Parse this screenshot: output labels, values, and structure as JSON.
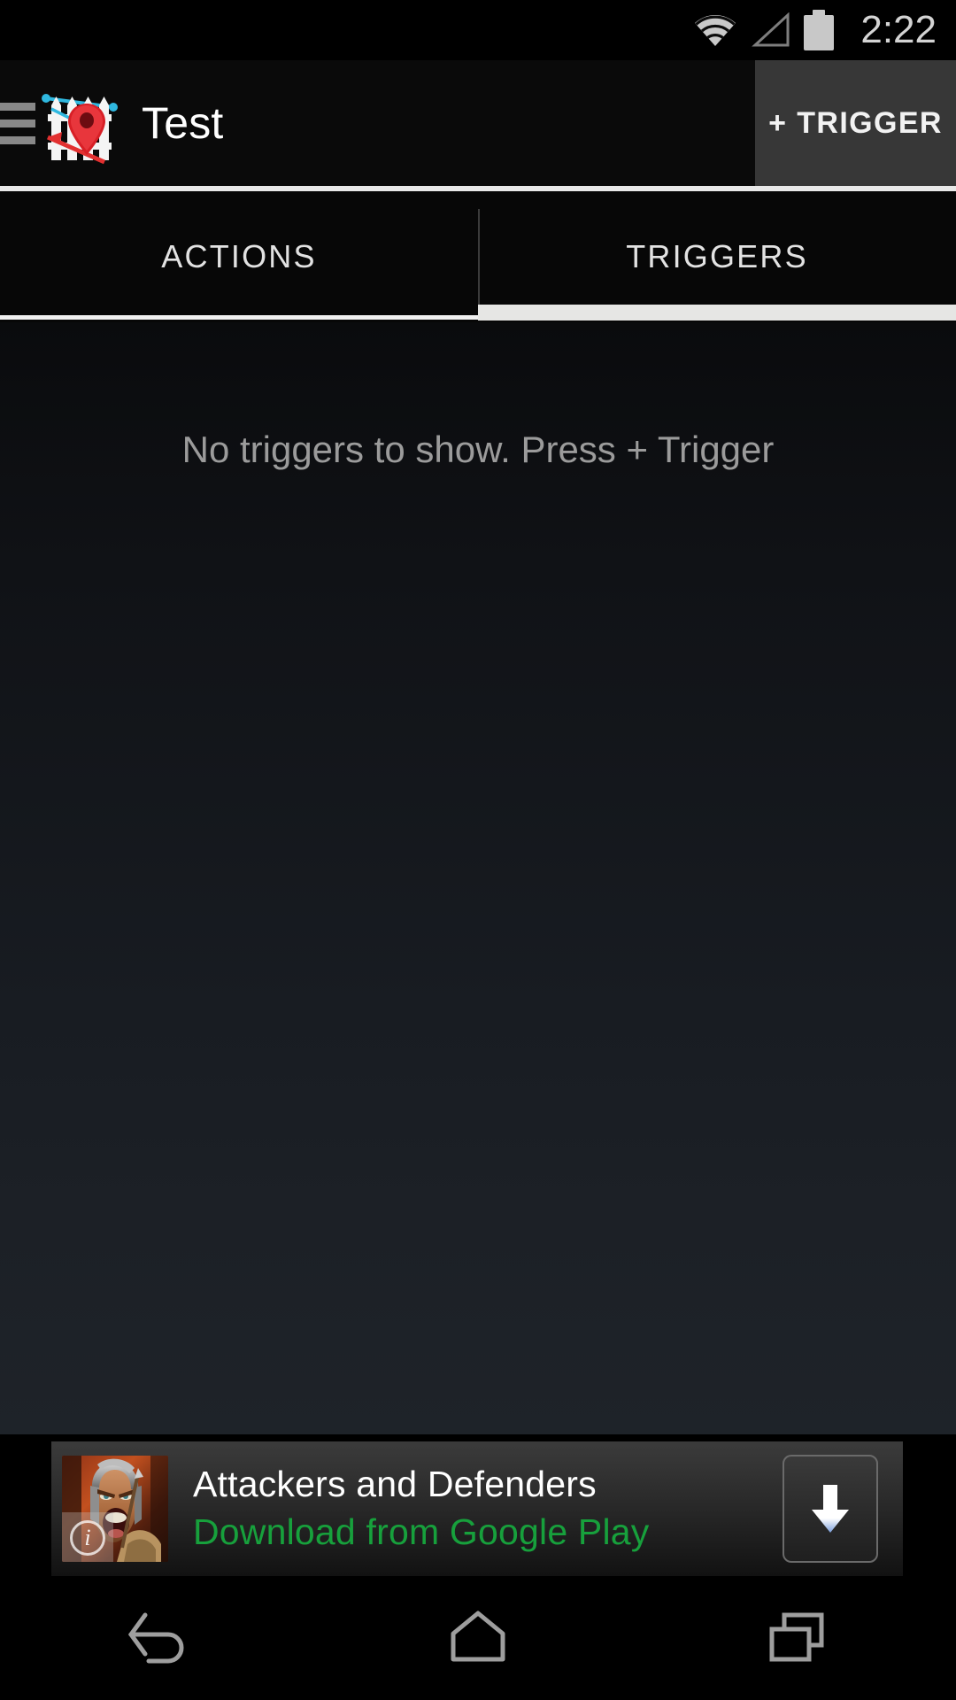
{
  "status_bar": {
    "clock": "2:22",
    "icons": [
      {
        "name": "wifi-icon",
        "state": "full"
      },
      {
        "name": "cell-signal-icon",
        "state": "no-service"
      },
      {
        "name": "battery-icon",
        "state": "full"
      }
    ]
  },
  "action_bar": {
    "drawer_icon": "hamburger-menu-icon",
    "app_icon": "geofence-map-pin-icon",
    "title": "Test",
    "action_button": {
      "label": "+ TRIGGER",
      "highlighted": true,
      "background": "#373737"
    }
  },
  "tabs": {
    "items": [
      {
        "label": "ACTIONS",
        "selected": false
      },
      {
        "label": "TRIGGERS",
        "selected": true
      }
    ],
    "indicator_color": "#e6e6e4"
  },
  "content": {
    "empty_message": "No triggers to show. Press + Trigger",
    "empty_message_color": "#9b9b9b"
  },
  "ad_banner": {
    "thumbnail_icon": "warrior-game-icon",
    "adchoices_badge": "i",
    "title": "Attackers and Defenders",
    "subtitle": "Download from Google Play",
    "subtitle_color": "#17a03c",
    "cta_icon": "download-arrow-icon"
  },
  "nav_bar": {
    "buttons": [
      {
        "name": "back-button",
        "icon": "back-arrow-icon"
      },
      {
        "name": "home-button",
        "icon": "home-icon"
      },
      {
        "name": "recents-button",
        "icon": "recent-apps-icon"
      }
    ],
    "icon_color": "#9e9e9e"
  }
}
